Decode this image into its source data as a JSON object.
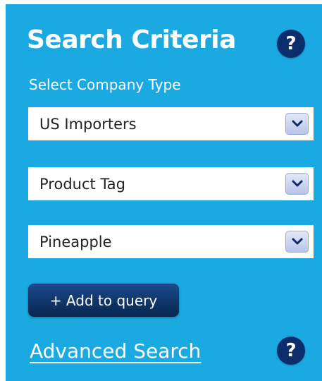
{
  "header": {
    "title": "Search Criteria",
    "help_label": "?"
  },
  "form": {
    "company_type_label": "Select Company Type",
    "selects": [
      {
        "value": "US Importers",
        "icon": "chevron-down-icon"
      },
      {
        "value": "Product Tag",
        "icon": "chevron-down-icon"
      },
      {
        "value": "Pineapple",
        "icon": "chevron-down-icon"
      }
    ],
    "add_button_label": "+ Add to query"
  },
  "footer": {
    "advanced_search_label": "Advanced Search",
    "help_label": "?"
  },
  "colors": {
    "panel_bg": "#1ba9e1",
    "button_dark": "#0c2d6b",
    "chevron": "#0c2d6b"
  }
}
